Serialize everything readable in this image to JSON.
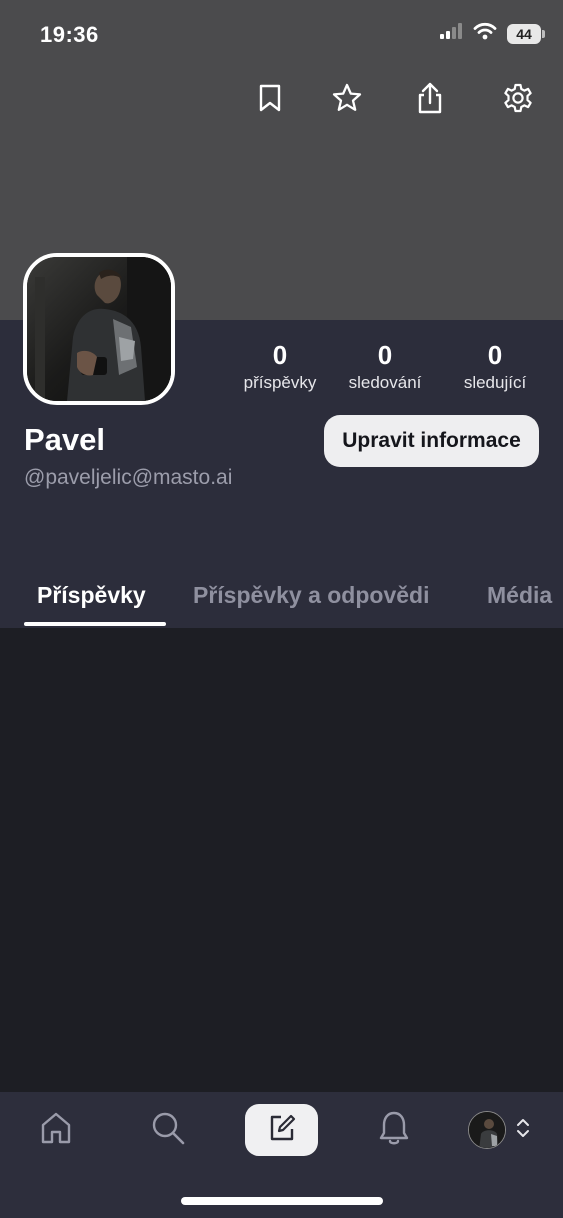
{
  "status_bar": {
    "time": "19:36",
    "battery": "44"
  },
  "top_actions": {
    "icons": [
      "bookmark-icon",
      "star-icon",
      "share-icon",
      "gear-icon"
    ]
  },
  "profile": {
    "display_name": "Pavel",
    "handle": "@paveljelic@masto.ai",
    "edit_button": "Upravit informace",
    "stats": [
      {
        "value": "0",
        "label": "příspěvky"
      },
      {
        "value": "0",
        "label": "sledování"
      },
      {
        "value": "0",
        "label": "sledující"
      }
    ]
  },
  "tabs": [
    {
      "label": "Příspěvky",
      "active": true
    },
    {
      "label": "Příspěvky a odpovědi",
      "active": false
    },
    {
      "label": "Média",
      "active": false
    }
  ],
  "tabbar": {
    "items": [
      "home-icon",
      "search-icon",
      "compose-icon",
      "bell-icon",
      "profile-avatar"
    ]
  },
  "colors": {
    "banner": "#4b4b4d",
    "panel": "#2c2d3b",
    "background": "#1d1e24",
    "tabbar": "#2d2e3c",
    "muted_text": "#9c9dab"
  }
}
